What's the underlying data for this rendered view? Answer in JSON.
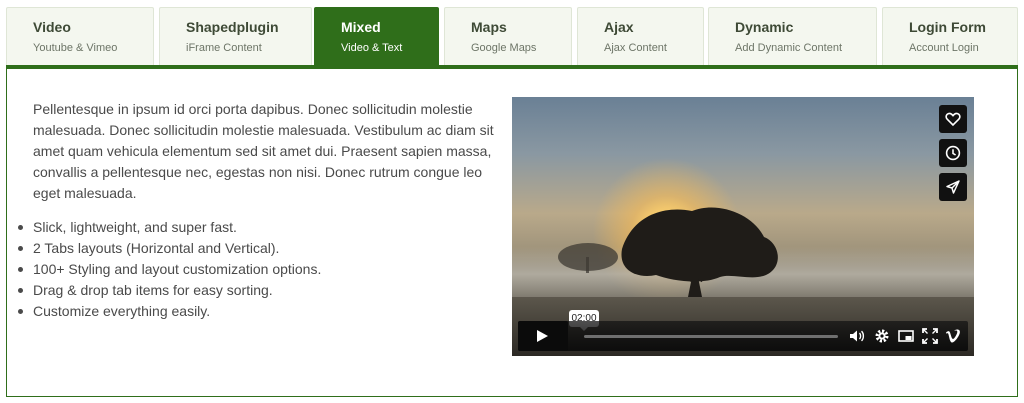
{
  "tabs": [
    {
      "title": "Video",
      "subtitle": "Youtube & Vimeo",
      "active": false
    },
    {
      "title": "Shapedplugin",
      "subtitle": "iFrame Content",
      "active": false
    },
    {
      "title": "Mixed",
      "subtitle": "Video & Text",
      "active": true
    },
    {
      "title": "Maps",
      "subtitle": "Google Maps",
      "active": false
    },
    {
      "title": "Ajax",
      "subtitle": "Ajax Content",
      "active": false
    },
    {
      "title": "Dynamic",
      "subtitle": "Add Dynamic Content",
      "active": false
    },
    {
      "title": "Login Form",
      "subtitle": "Account Login",
      "active": false
    }
  ],
  "content": {
    "description": "Pellentesque in ipsum id orci porta dapibus. Donec sollicitudin molestie malesuada. Donec sollicitudin molestie malesuada. Vestibulum ac diam sit amet quam vehicula elementum sed sit amet dui. Praesent sapien massa, convallis a pellentesque nec, egestas non nisi. Donec rutrum congue leo eget malesuada.",
    "features": [
      "Slick, lightweight, and super fast.",
      "2 Tabs layouts (Horizontal and Vertical).",
      "100+ Styling and layout customization options.",
      "Drag & drop tab items for easy sorting.",
      "Customize everything easily."
    ]
  },
  "video": {
    "time_tooltip": "02:00",
    "side_buttons": [
      "heart-icon",
      "clock-icon",
      "send-icon"
    ],
    "controls": [
      "play-icon",
      "volume-icon",
      "settings-icon",
      "pip-icon",
      "fullscreen-icon",
      "vimeo-logo-icon"
    ]
  },
  "colors": {
    "accent": "#2f6e1a",
    "tab_bg": "#f4f7ef",
    "text": "#4a4a4a"
  }
}
